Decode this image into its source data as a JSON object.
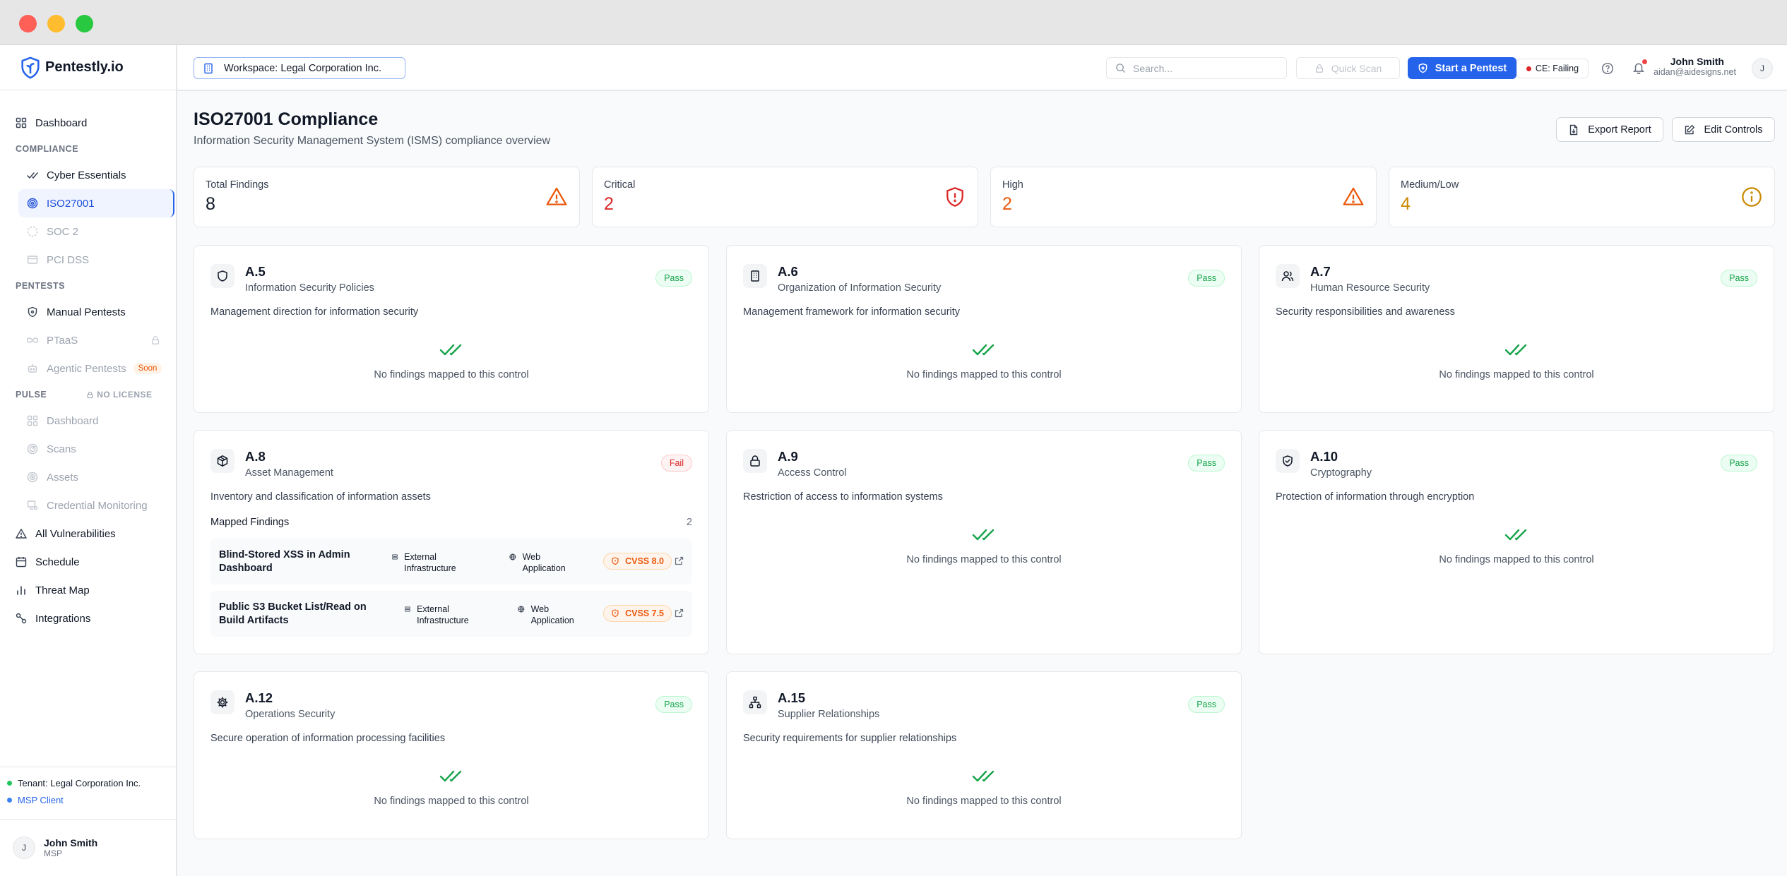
{
  "app": {
    "name": "Pentestly.io"
  },
  "sidebar": {
    "dashboard": "Dashboard",
    "compliance_label": "COMPLIANCE",
    "compliance_items": [
      "Cyber Essentials",
      "ISO27001",
      "SOC 2",
      "PCI DSS"
    ],
    "pentests_label": "PENTESTS",
    "manual_pentests": "Manual Pentests",
    "ptaas": "PTaaS",
    "agentic": "Agentic Pentests",
    "soon": "Soon",
    "pulse_label": "PULSE",
    "no_license": "NO LICENSE",
    "pulse_items": [
      "Dashboard",
      "Scans",
      "Assets",
      "Credential Monitoring"
    ],
    "all_vulns": "All Vulnerabilities",
    "schedule": "Schedule",
    "threat_map": "Threat Map",
    "integrations": "Integrations",
    "tenant": "Tenant: Legal Corporation Inc.",
    "msp_client": "MSP Client",
    "user_initial": "J",
    "user_name": "John Smith",
    "user_role": "MSP"
  },
  "topbar": {
    "workspace": "Workspace: Legal Corporation Inc.",
    "search_placeholder": "Search...",
    "quick_scan": "Quick Scan",
    "start_pentest": "Start a Pentest",
    "ce_status": "CE: Failing",
    "user_name": "John Smith",
    "user_email": "aidan@aidesigns.net",
    "user_initial": "J"
  },
  "page": {
    "title": "ISO27001 Compliance",
    "subtitle": "Information Security Management System (ISMS) compliance overview",
    "export": "Export Report",
    "edit": "Edit Controls"
  },
  "stats": [
    {
      "label": "Total Findings",
      "value": "8",
      "color": "#111827"
    },
    {
      "label": "Critical",
      "value": "2",
      "color": "#dc2626"
    },
    {
      "label": "High",
      "value": "2",
      "color": "#ea580c"
    },
    {
      "label": "Medium/Low",
      "value": "4",
      "color": "#ca8a04"
    }
  ],
  "no_findings_text": "No findings mapped to this control",
  "controls": [
    {
      "id": "A.5",
      "name": "Information Security Policies",
      "desc": "Management direction for information security",
      "status": "Pass",
      "icon": "shield-icon"
    },
    {
      "id": "A.6",
      "name": "Organization of Information Security",
      "desc": "Management framework for information security",
      "status": "Pass",
      "icon": "building-icon"
    },
    {
      "id": "A.7",
      "name": "Human Resource Security",
      "desc": "Security responsibilities and awareness",
      "status": "Pass",
      "icon": "users-icon"
    },
    {
      "id": "A.8",
      "name": "Asset Management",
      "desc": "Inventory and classification of information assets",
      "status": "Fail",
      "icon": "box-icon",
      "mapped_label": "Mapped Findings",
      "mapped_count": "2",
      "findings": [
        {
          "title": "Blind-Stored XSS in Admin Dashboard",
          "tag1": "External Infrastructure",
          "tag2": "Web Application",
          "cvss": "CVSS 8.0"
        },
        {
          "title": "Public S3 Bucket List/Read on Build Artifacts",
          "tag1": "External Infrastructure",
          "tag2": "Web Application",
          "cvss": "CVSS 7.5"
        }
      ]
    },
    {
      "id": "A.9",
      "name": "Access Control",
      "desc": "Restriction of access to information systems",
      "status": "Pass",
      "icon": "lock-icon"
    },
    {
      "id": "A.10",
      "name": "Cryptography",
      "desc": "Protection of information through encryption",
      "status": "Pass",
      "icon": "shield-check-icon"
    },
    {
      "id": "A.12",
      "name": "Operations Security",
      "desc": "Secure operation of information processing facilities",
      "status": "Pass",
      "icon": "cog-icon"
    },
    {
      "id": "A.15",
      "name": "Supplier Relationships",
      "desc": "Security requirements for supplier relationships",
      "status": "Pass",
      "icon": "network-icon"
    }
  ]
}
